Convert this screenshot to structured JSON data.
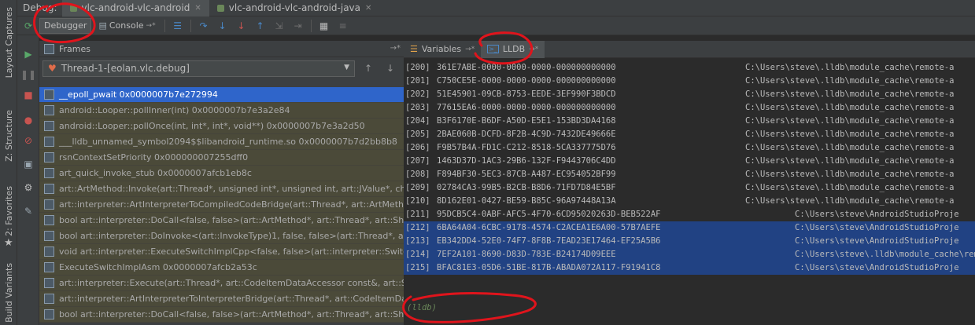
{
  "title_bar": {
    "debug_label": "Debug:",
    "run_tabs": [
      {
        "label": "vlc-android-vlc-android"
      },
      {
        "label": "vlc-android-vlc-android-java"
      }
    ]
  },
  "side_tabs": [
    {
      "label": "Layout Captures"
    },
    {
      "label": "Z: Structure"
    },
    {
      "label": "2: Favorites"
    },
    {
      "label": "Build Variants"
    }
  ],
  "toolbar": {
    "debugger_label": "Debugger",
    "console_label": "Console",
    "console_pin": "→*"
  },
  "frames": {
    "title": "Frames",
    "pin": "→*",
    "thread": "Thread-1-[eolan.vlc.debug]",
    "items": [
      {
        "label": "__epoll_pwait 0x0000007b7e272994"
      },
      {
        "label": "android::Looper::pollInner(int) 0x0000007b7e3a2e84"
      },
      {
        "label": "android::Looper::pollOnce(int, int*, int*, void**) 0x0000007b7e3a2d50"
      },
      {
        "label": "___lldb_unnamed_symbol2094$$libandroid_runtime.so 0x0000007b7d2bb8b8"
      },
      {
        "label": "rsnContextSetPriority 0x000000007255dff0"
      },
      {
        "label": "art_quick_invoke_stub 0x0000007afcb1eb8c"
      },
      {
        "label": "art::ArtMethod::Invoke(art::Thread*, unsigned int*, unsigned int, art::JValue*, char c"
      },
      {
        "label": "art::interpreter::ArtInterpreterToCompiledCodeBridge(art::Thread*, art::ArtMethod*"
      },
      {
        "label": "bool art::interpreter::DoCall<false, false>(art::ArtMethod*, art::Thread*, art::Shadow"
      },
      {
        "label": "bool art::interpreter::DoInvoke<(art::InvokeType)1, false, false>(art::Thread*, art::Sh"
      },
      {
        "label": "void art::interpreter::ExecuteSwitchImplCpp<false, false>(art::interpreter::SwitchImpl"
      },
      {
        "label": "ExecuteSwitchImplAsm 0x0000007afcb2a53c"
      },
      {
        "label": "art::interpreter::Execute(art::Thread*, art::CodeItemDataAccessor const&, art::Shado"
      },
      {
        "label": "art::interpreter::ArtInterpreterToInterpreterBridge(art::Thread*, art::CodeItemDataAcc"
      },
      {
        "label": "bool art::interpreter::DoCall<false, false>(art::ArtMethod*, art::Thread*, art::Shadow"
      }
    ]
  },
  "right_tabs": {
    "variables_label": "Variables",
    "variables_pin": "→*",
    "lldb_label": "LLDB",
    "lldb_pin": "→*"
  },
  "console": {
    "lines": [
      {
        "idx": "[200]",
        "uuid": "361E7ABE-0000-0000-0000-000000000000",
        "path": "C:\\Users\\steve\\.lldb\\module_cache\\remote-a"
      },
      {
        "idx": "[201]",
        "uuid": "C750CE5E-0000-0000-0000-000000000000",
        "path": "C:\\Users\\steve\\.lldb\\module_cache\\remote-a"
      },
      {
        "idx": "[202]",
        "uuid": "51E45901-09CB-8753-EEDE-3EF990F3BDCD",
        "path": "C:\\Users\\steve\\.lldb\\module_cache\\remote-a"
      },
      {
        "idx": "[203]",
        "uuid": "77615EA6-0000-0000-0000-000000000000",
        "path": "C:\\Users\\steve\\.lldb\\module_cache\\remote-a"
      },
      {
        "idx": "[204]",
        "uuid": "B3F6170E-B6DF-A50D-E5E1-153BD3DA4168",
        "path": "C:\\Users\\steve\\.lldb\\module_cache\\remote-a"
      },
      {
        "idx": "[205]",
        "uuid": "2BAE060B-DCFD-8F2B-4C9D-7432DE49666E",
        "path": "C:\\Users\\steve\\.lldb\\module_cache\\remote-a"
      },
      {
        "idx": "[206]",
        "uuid": "F9B57B4A-FD1C-C212-8518-5CA337775D76",
        "path": "C:\\Users\\steve\\.lldb\\module_cache\\remote-a"
      },
      {
        "idx": "[207]",
        "uuid": "1463D37D-1AC3-29B6-132F-F9443706C4DD",
        "path": "C:\\Users\\steve\\.lldb\\module_cache\\remote-a"
      },
      {
        "idx": "[208]",
        "uuid": "F894BF30-5EC3-87CB-A487-EC954052BF99",
        "path": "C:\\Users\\steve\\.lldb\\module_cache\\remote-a"
      },
      {
        "idx": "[209]",
        "uuid": "02784CA3-99B5-B2CB-B8D6-71FD7D84E5BF",
        "path": "C:\\Users\\steve\\.lldb\\module_cache\\remote-a"
      },
      {
        "idx": "[210]",
        "uuid": "8D162E01-0427-BE59-B85C-96A97448A13A",
        "path": "C:\\Users\\steve\\.lldb\\module_cache\\remote-a"
      },
      {
        "idx": "[211]",
        "uuid": "95DCB5C4-0ABF-AFC5-4F70-6CD95020263D-BEB522AF",
        "path": "C:\\Users\\steve\\AndroidStudioProje",
        "deep": true
      },
      {
        "idx": "[212]",
        "uuid": "6BA64A04-6CBC-9178-4574-C2ACEA1E6A00-57B7AEFE",
        "path": "C:\\Users\\steve\\AndroidStudioProje",
        "deep": true,
        "hl": true
      },
      {
        "idx": "[213]",
        "uuid": "EB342DD4-52E0-74F7-8F8B-7EAD23E17464-EF25A5B6",
        "path": "C:\\Users\\steve\\AndroidStudioProje",
        "deep": true,
        "hl": true
      },
      {
        "idx": "[214]",
        "uuid": "7EF2A101-8690-D83D-783E-B24174D09EEE",
        "path": "C:\\Users\\steve\\.lldb\\module_cache\\remote-a",
        "deep": true,
        "hl": true
      },
      {
        "idx": "[215]",
        "uuid": "BFAC81E3-05D6-51BE-817B-ABADA072A117-F91941C8",
        "path": "C:\\Users\\steve\\AndroidStudioProje",
        "deep": true,
        "hl": true
      }
    ],
    "prompt": "(lldb)"
  },
  "colors": {
    "selection": "#2f65ca",
    "highlight": "#214283",
    "annotation": "#e0141c",
    "frame_bg": "#4b4a39"
  }
}
